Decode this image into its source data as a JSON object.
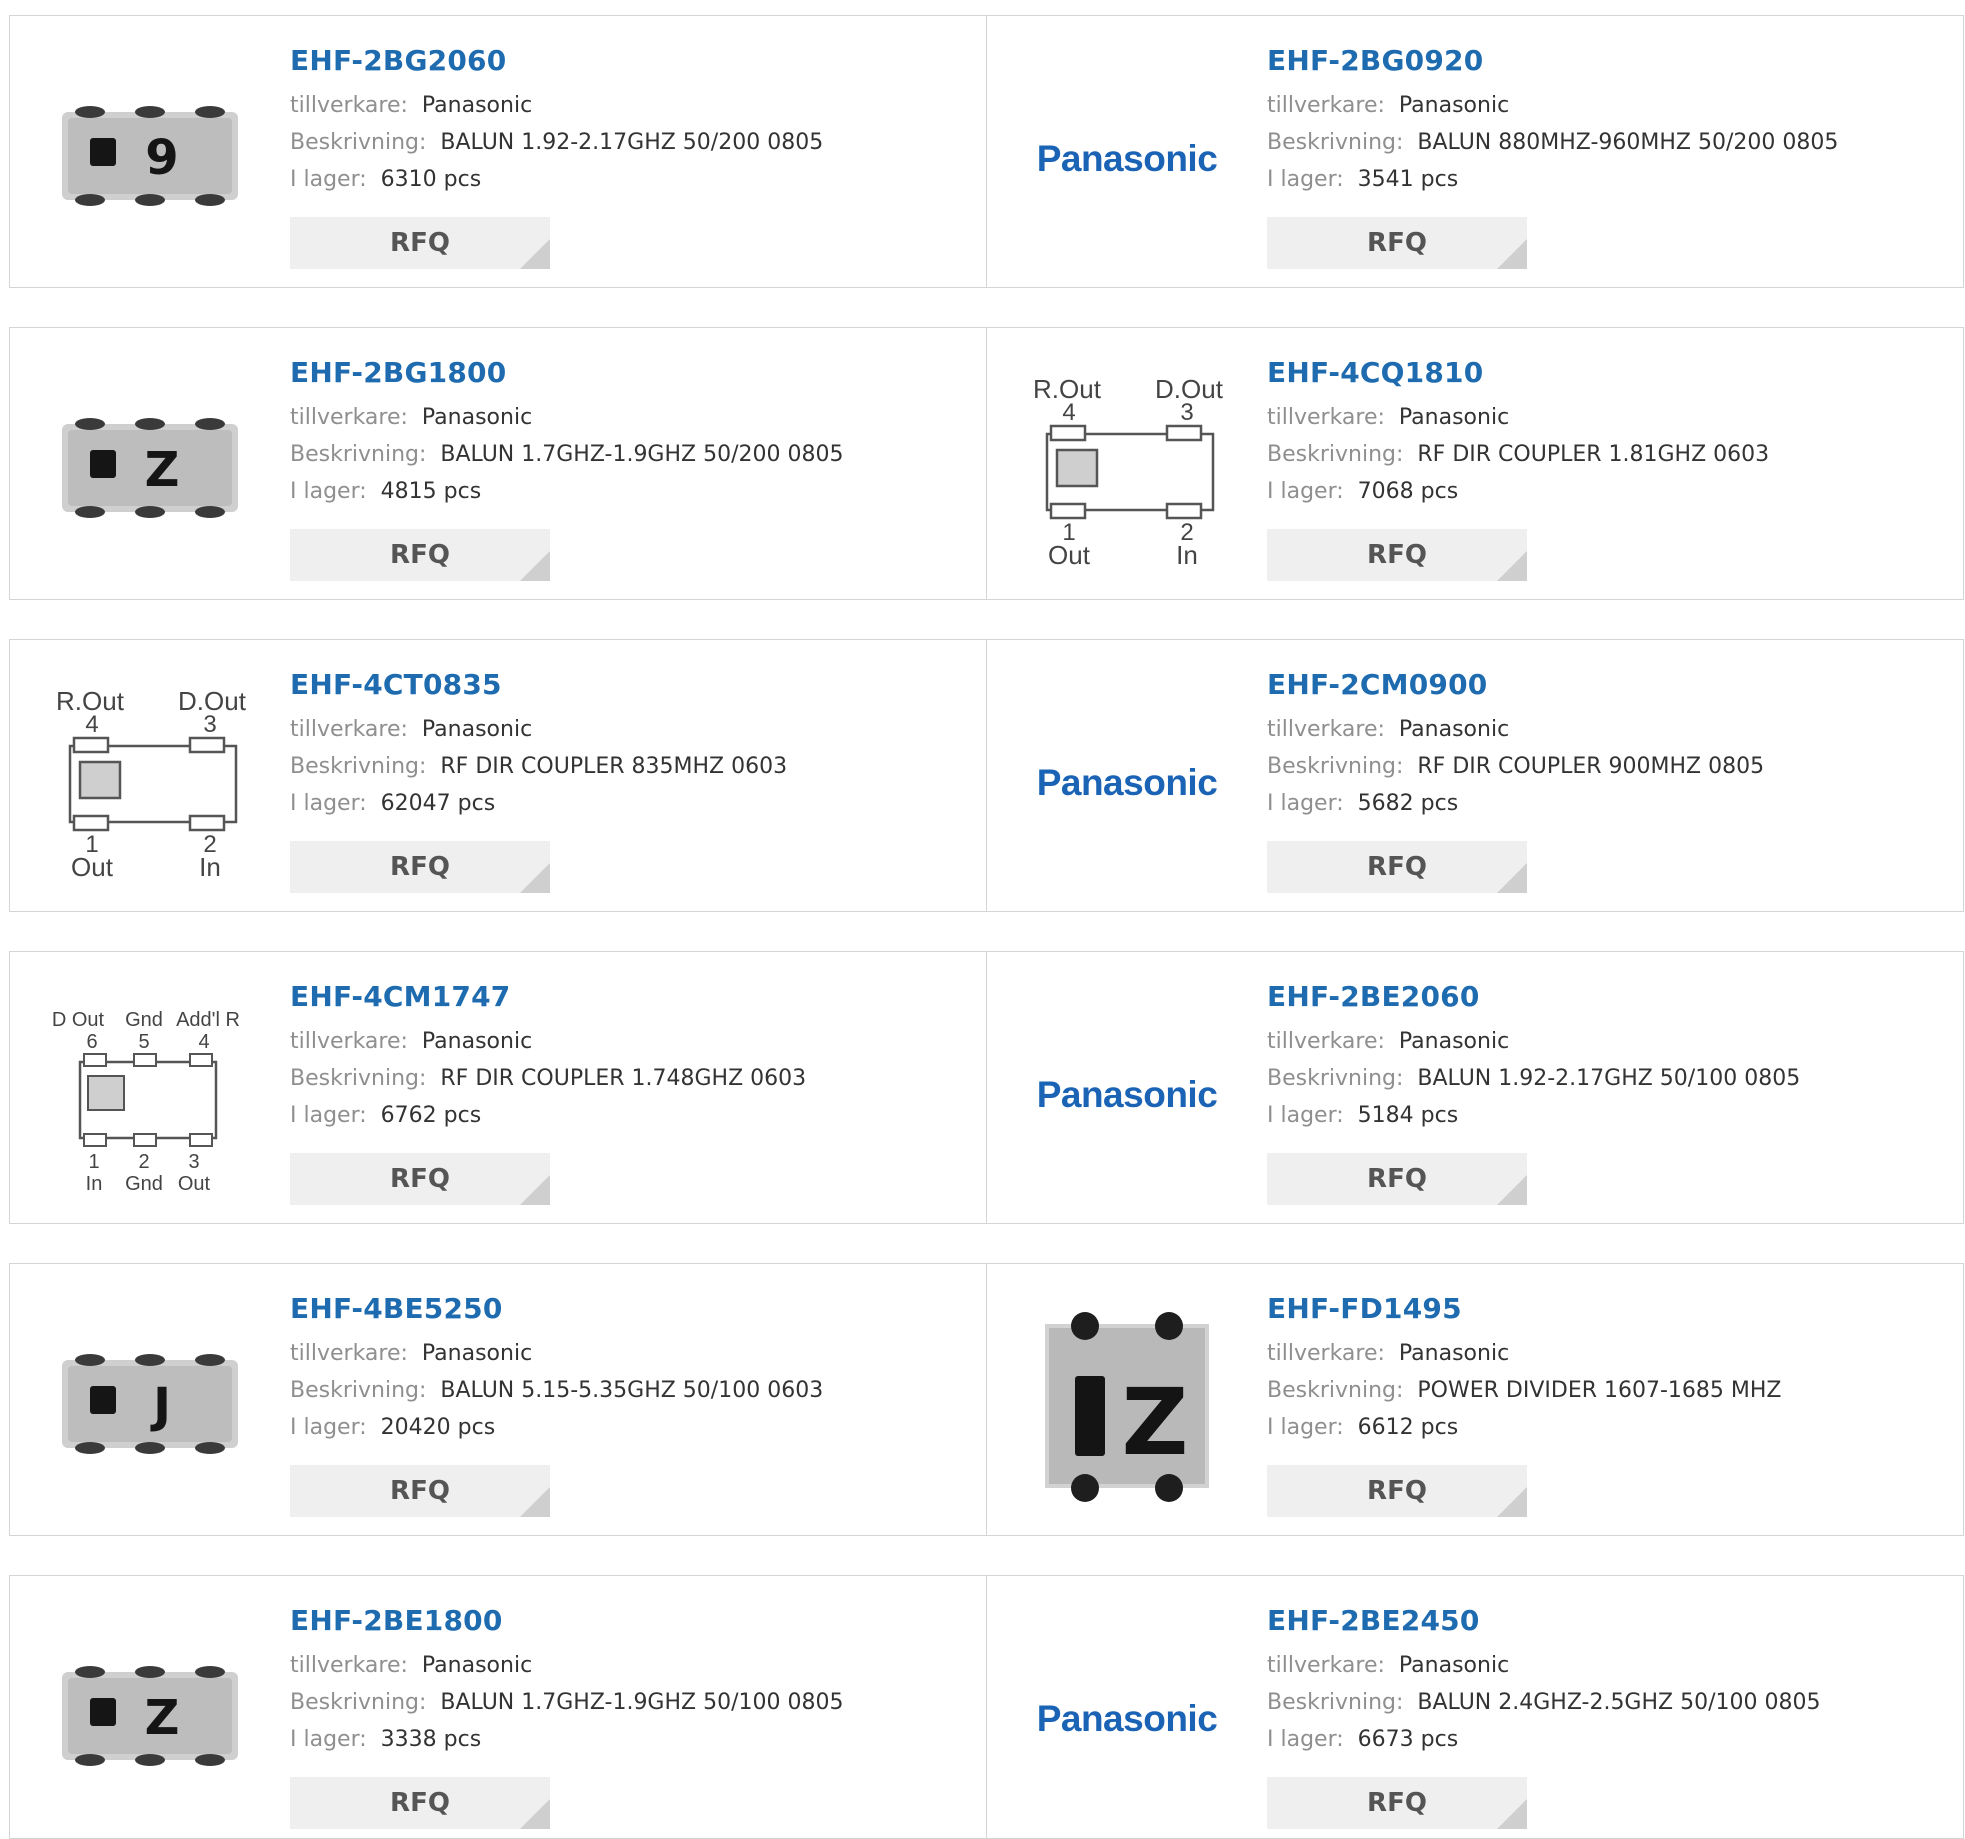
{
  "labels": {
    "manufacturer": "tillverkare:",
    "description": "Beskrivning:",
    "stock": "I lager:",
    "rfq": "RFQ"
  },
  "brand_logo_text": "Panasonic",
  "rows": [
    {
      "left": {
        "name": "EHF-2BG2060",
        "manufacturer": "Panasonic",
        "description": "BALUN 1.92-2.17GHZ 50/200 0805",
        "stock": "6310 pcs",
        "thumb": "chip-photo",
        "chip_mark": "9"
      },
      "right": {
        "name": "EHF-2BG0920",
        "manufacturer": "Panasonic",
        "description": "BALUN 880MHZ-960MHZ 50/200 0805",
        "stock": "3541 pcs",
        "thumb": "panasonic-logo"
      }
    },
    {
      "left": {
        "name": "EHF-2BG1800",
        "manufacturer": "Panasonic",
        "description": "BALUN 1.7GHZ-1.9GHZ 50/200 0805",
        "stock": "4815 pcs",
        "thumb": "chip-photo",
        "chip_mark": "Z"
      },
      "right": {
        "name": "EHF-4CQ1810",
        "manufacturer": "Panasonic",
        "description": "RF DIR COUPLER 1.81GHZ 0603",
        "stock": "7068 pcs",
        "thumb": "coupler-4pin",
        "pins": {
          "top_left": "R.Out",
          "top_right": "D.Out",
          "n4": "4",
          "n3": "3",
          "n1": "1",
          "n2": "2",
          "bottom_left": "Out",
          "bottom_right": "In"
        }
      }
    },
    {
      "left": {
        "name": "EHF-4CT0835",
        "manufacturer": "Panasonic",
        "description": "RF DIR COUPLER 835MHZ 0603",
        "stock": "62047 pcs",
        "thumb": "coupler-4pin",
        "pins": {
          "top_left": "R.Out",
          "top_right": "D.Out",
          "n4": "4",
          "n3": "3",
          "n1": "1",
          "n2": "2",
          "bottom_left": "Out",
          "bottom_right": "In"
        }
      },
      "right": {
        "name": "EHF-2CM0900",
        "manufacturer": "Panasonic",
        "description": "RF DIR COUPLER 900MHZ 0805",
        "stock": "5682 pcs",
        "thumb": "panasonic-logo"
      }
    },
    {
      "left": {
        "name": "EHF-4CM1747",
        "manufacturer": "Panasonic",
        "description": "RF DIR COUPLER 1.748GHZ 0603",
        "stock": "6762 pcs",
        "thumb": "coupler-6pin",
        "pins": {
          "t1": "D Out",
          "t2": "Gnd",
          "t3": "Add'l R",
          "n6": "6",
          "n5": "5",
          "n4": "4",
          "n1": "1",
          "n2": "2",
          "n3": "3",
          "b1": "In",
          "b2": "Gnd",
          "b3": "Out"
        }
      },
      "right": {
        "name": "EHF-2BE2060",
        "manufacturer": "Panasonic",
        "description": "BALUN 1.92-2.17GHZ 50/100 0805",
        "stock": "5184 pcs",
        "thumb": "panasonic-logo"
      }
    },
    {
      "left": {
        "name": "EHF-4BE5250",
        "manufacturer": "Panasonic",
        "description": "BALUN 5.15-5.35GHZ 50/100 0603",
        "stock": "20420 pcs",
        "thumb": "chip-photo",
        "chip_mark": "J"
      },
      "right": {
        "name": "EHF-FD1495",
        "manufacturer": "Panasonic",
        "description": "POWER DIVIDER 1607-1685 MHZ",
        "stock": "6612 pcs",
        "thumb": "chip-photo-square",
        "chip_mark": "Z"
      }
    },
    {
      "left": {
        "name": "EHF-2BE1800",
        "manufacturer": "Panasonic",
        "description": "BALUN 1.7GHZ-1.9GHZ 50/100 0805",
        "stock": "3338 pcs",
        "thumb": "chip-photo",
        "chip_mark": "Z"
      },
      "right": {
        "name": "EHF-2BE2450",
        "manufacturer": "Panasonic",
        "description": "BALUN 2.4GHZ-2.5GHZ 50/100 0805",
        "stock": "6673 pcs",
        "thumb": "panasonic-logo"
      }
    }
  ]
}
